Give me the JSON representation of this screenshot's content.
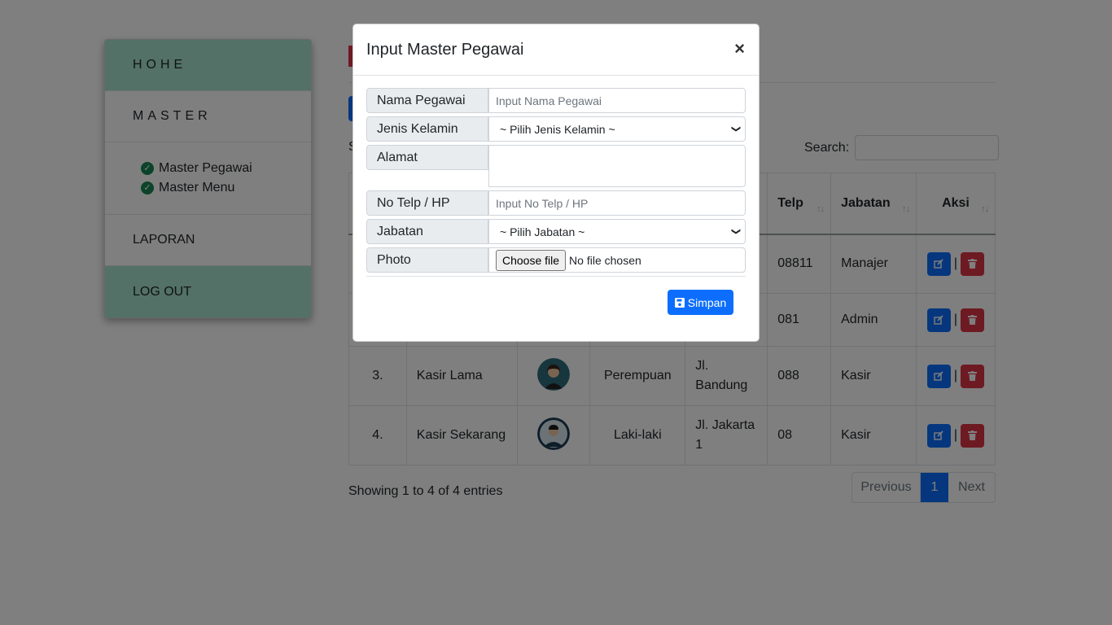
{
  "sidebar": {
    "items": [
      {
        "label": "HOHE"
      },
      {
        "label": "MASTER"
      },
      {
        "label": "LAPORAN"
      },
      {
        "label": "LOG OUT"
      }
    ],
    "sub_items": [
      {
        "label": "Master Pegawai"
      },
      {
        "label": "Master Menu"
      }
    ]
  },
  "main": {
    "show_stub": "S",
    "search_label": "Search:",
    "columns": {
      "telp": "Telp",
      "jabatan": "Jabatan",
      "aksi": "Aksi"
    },
    "sort_glyph": "↑↓",
    "rows": [
      {
        "no": "",
        "nama": "",
        "jk": "",
        "alamat": "",
        "telp": "08811",
        "jabatan": "Manajer"
      },
      {
        "no": "",
        "nama": "",
        "jk": "",
        "alamat": "",
        "telp": "081",
        "jabatan": "Admin"
      },
      {
        "no": "3.",
        "nama": "Kasir Lama",
        "jk": "Perempuan",
        "alamat": "Jl. Bandung",
        "telp": "088",
        "jabatan": "Kasir"
      },
      {
        "no": "4.",
        "nama": "Kasir Sekarang",
        "jk": "Laki-laki",
        "alamat": "Jl. Jakarta 1",
        "telp": "08",
        "jabatan": "Kasir"
      }
    ],
    "info": "Showing 1 to 4 of 4 entries",
    "pager": {
      "prev": "Previous",
      "current": "1",
      "next": "Next"
    }
  },
  "modal": {
    "title": "Input Master Pegawai",
    "close": "×",
    "fields": {
      "nama_label": "Nama Pegawai",
      "nama_placeholder": "Input Nama Pegawai",
      "jk_label": "Jenis Kelamin",
      "jk_value": "~ Pilih Jenis Kelamin ~",
      "alamat_label": "Alamat",
      "telp_label": "No Telp / HP",
      "telp_placeholder": "Input No Telp / HP",
      "jabatan_label": "Jabatan",
      "jabatan_value": "~ Pilih Jabatan ~",
      "photo_label": "Photo",
      "file_button": "Choose file",
      "file_status": "No file chosen"
    },
    "save_label": "Simpan"
  },
  "colors": {
    "primary": "#0d6efd",
    "danger": "#dc3545",
    "success": "#198754",
    "sidebar_green": "#a6e3cc"
  }
}
